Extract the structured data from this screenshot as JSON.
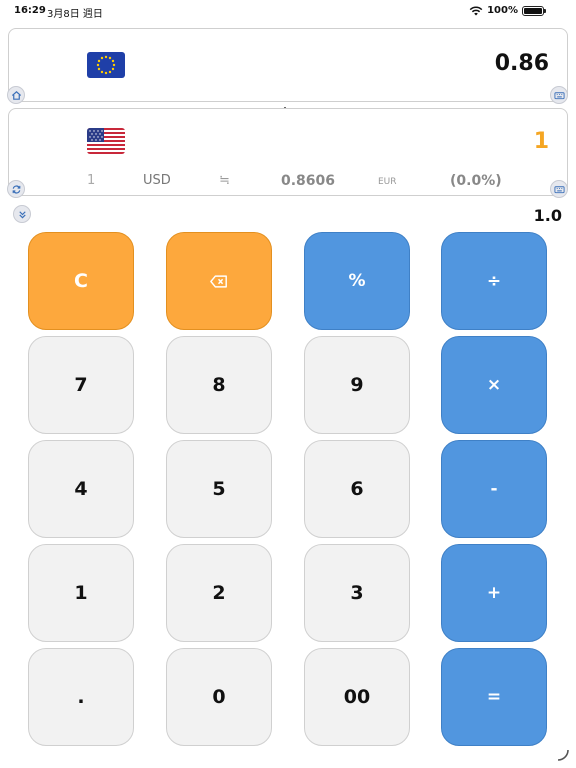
{
  "status_bar": {
    "time": "16:29",
    "date": "3月8日 週日",
    "battery": "100%"
  },
  "top_card": {
    "flag_icon": "eu-flag-icon",
    "value": "0.86"
  },
  "bottom_card": {
    "flag_icon": "us-flag-icon",
    "value": "1",
    "rate": {
      "amount": "1",
      "from_currency": "USD",
      "approx_symbol": "≒",
      "rate_value": "0.8606",
      "to_currency": "EUR",
      "change": "(0.0%)"
    }
  },
  "multiplier": "1.0",
  "icons": {
    "home": "home-icon",
    "keyboard": "keyboard-icon",
    "sync": "sync-icon",
    "expand": "chevron-double-down-icon",
    "swap": "swap-vertical-icon"
  },
  "keypad": {
    "clear": "C",
    "backspace": "⌫",
    "percent": "%",
    "divide": "÷",
    "seven": "7",
    "eight": "8",
    "nine": "9",
    "multiply": "×",
    "four": "4",
    "five": "5",
    "six": "6",
    "minus": "-",
    "one": "1",
    "two": "2",
    "three": "3",
    "plus": "+",
    "dot": ".",
    "zero": "0",
    "double_zero": "00",
    "equals": "="
  },
  "colors": {
    "accent_orange": "#fda83d",
    "accent_blue": "#5196df",
    "key_gray": "#f2f2f2",
    "result_orange": "#f5a623"
  }
}
